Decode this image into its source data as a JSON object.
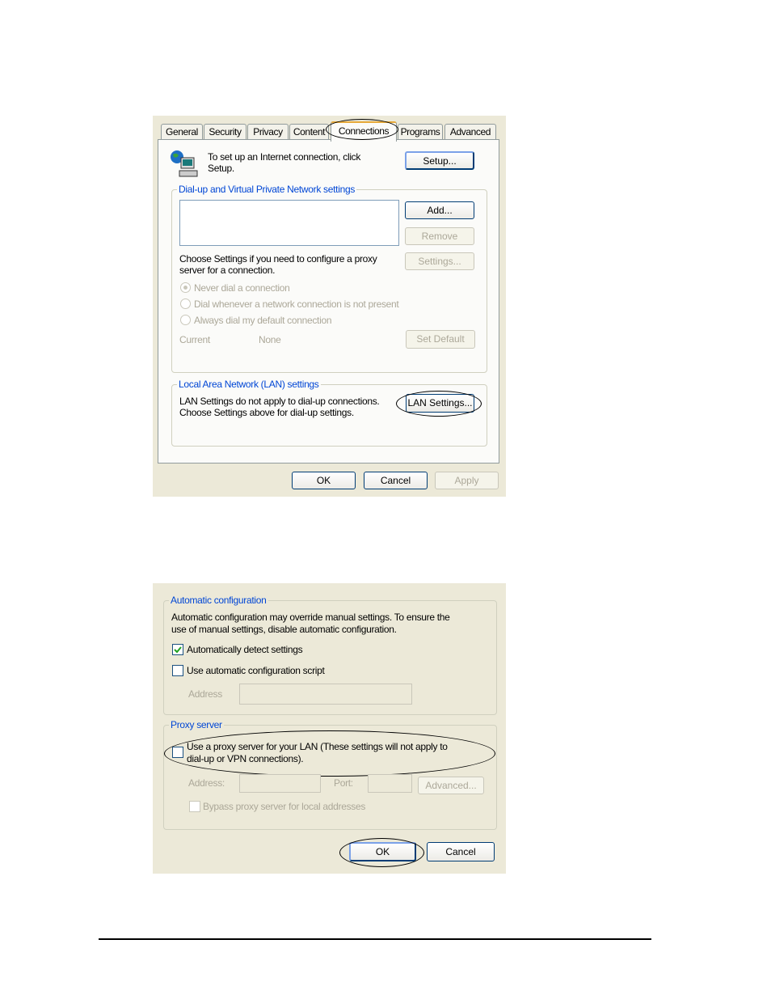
{
  "dialog1": {
    "tabs": [
      "General",
      "Security",
      "Privacy",
      "Content",
      "Connections",
      "Programs",
      "Advanced"
    ],
    "selected_tab": "Connections",
    "setup_text_1": "To set up an Internet connection, click",
    "setup_text_2": "Setup.",
    "setup_button": "Setup...",
    "dialup_legend": "Dial-up and Virtual Private Network settings",
    "add_button": "Add...",
    "remove_button": "Remove",
    "settings_button": "Settings...",
    "proxy_text_1": "Choose Settings if you need to configure a proxy",
    "proxy_text_2": "server for a connection.",
    "radios": [
      "Never dial a connection",
      "Dial whenever a network connection is not present",
      "Always dial my default connection"
    ],
    "current_label": "Current",
    "current_value": "None",
    "set_default_button": "Set Default",
    "lan_legend": "Local Area Network (LAN) settings",
    "lan_text_1": "LAN Settings do not apply to dial-up connections.",
    "lan_text_2": "Choose Settings above for dial-up settings.",
    "lan_settings_button": "LAN Settings...",
    "ok": "OK",
    "cancel": "Cancel",
    "apply": "Apply"
  },
  "dialog2": {
    "auto_legend": "Automatic configuration",
    "auto_text_1": "Automatic configuration may override manual settings.  To ensure the",
    "auto_text_2": "use of manual settings, disable automatic configuration.",
    "auto_detect_label": "Automatically detect settings",
    "auto_detect_checked": true,
    "auto_script_label": "Use automatic configuration script",
    "auto_script_checked": false,
    "address_label": "Address",
    "proxy_legend": "Proxy server",
    "proxy_label_1": "Use a proxy server for your LAN (These settings will not apply to",
    "proxy_label_2": "dial-up or VPN connections).",
    "proxy_checked": false,
    "proxy_address_label": "Address:",
    "port_label": "Port:",
    "advanced_button": "Advanced...",
    "bypass_label": "Bypass proxy server for local addresses",
    "ok": "OK",
    "cancel": "Cancel"
  },
  "colors": {
    "legend": "#0046d5",
    "dialog_bg": "#ece9d8",
    "tab_highlight": "#e6a93a"
  }
}
